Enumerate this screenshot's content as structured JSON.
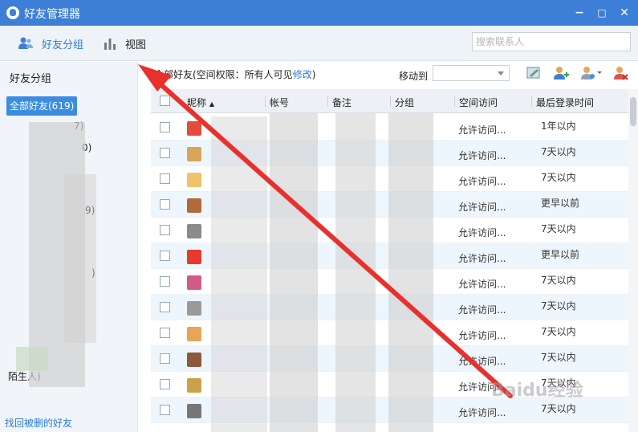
{
  "window": {
    "title": "好友管理器",
    "min": "−",
    "max": "□",
    "close": "✕"
  },
  "toolbar": {
    "friend_groups": "好友分组",
    "view": "视图",
    "search_placeholder": "搜索联系人"
  },
  "sidebar": {
    "title": "好友分组",
    "items": [
      {
        "label": "全部好友(619)",
        "active": true
      },
      {
        "label": "7)"
      },
      {
        "label": "0)"
      },
      {
        "label": "9)"
      },
      {
        "label": ")"
      },
      {
        "label": "陌生人)"
      }
    ],
    "recover_link": "找回被删的好友"
  },
  "main": {
    "header_prefix": "全部好友(空间权限：所有人可见",
    "header_link": "修改",
    "header_suffix": ")",
    "move_to": "移动到"
  },
  "table": {
    "columns": [
      "昵称",
      "帐号",
      "备注",
      "分组",
      "空间访问",
      "最后登录时间"
    ],
    "sort_indicator": "▲",
    "rows": [
      {
        "access": "允许访问...",
        "last_login": "1年以内"
      },
      {
        "access": "允许访问...",
        "last_login": "7天以内"
      },
      {
        "access": "允许访问...",
        "last_login": "7天以内"
      },
      {
        "access": "允许访问...",
        "last_login": "更早以前"
      },
      {
        "access": "允许访问...",
        "last_login": "7天以内"
      },
      {
        "access": "允许访问...",
        "last_login": "更早以前"
      },
      {
        "access": "允许访问...",
        "last_login": "7天以内"
      },
      {
        "access": "允许访问...",
        "last_login": "7天以内"
      },
      {
        "access": "允许访问...",
        "last_login": "7天以内"
      },
      {
        "access": "允许访问...",
        "last_login": "7天以内"
      },
      {
        "access": "允许访问...",
        "last_login": "7天以内"
      },
      {
        "access": "允许访问...",
        "last_login": "7天以内"
      }
    ]
  },
  "colors": {
    "titlebar": "#3d7fd6",
    "accent": "#3c8ce0",
    "link": "#2f7bd3",
    "arrow": "#e8302c"
  },
  "watermark": "Baidu经验"
}
